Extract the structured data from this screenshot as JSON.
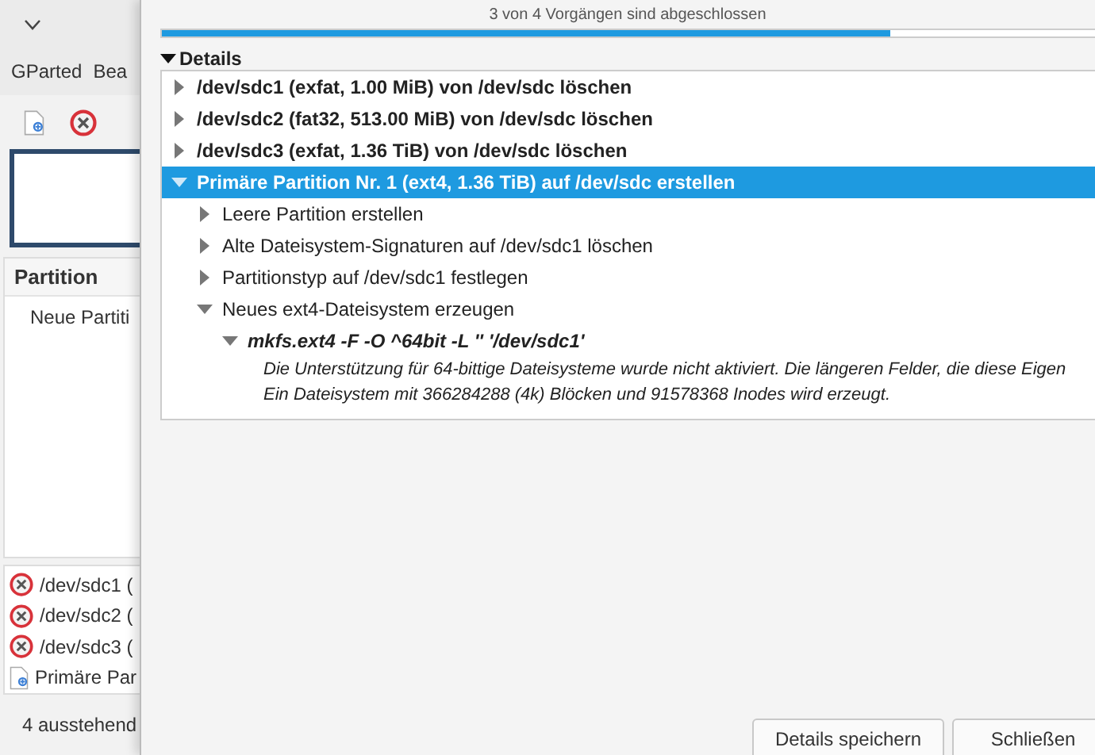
{
  "main_window": {
    "menu": [
      "GParted",
      "Bea"
    ],
    "partition_list": {
      "columns": [
        "Partition"
      ],
      "rows": [
        "Neue Partiti"
      ]
    },
    "pending_operations": [
      {
        "kind": "delete",
        "label": "/dev/sdc1 ("
      },
      {
        "kind": "delete",
        "label": "/dev/sdc2 ("
      },
      {
        "kind": "delete",
        "label": "/dev/sdc3 ("
      },
      {
        "kind": "create",
        "label": "Primäre Par"
      }
    ],
    "status_bar": "4 ausstehend"
  },
  "dialog": {
    "progress": {
      "text": "3 von 4 Vorgängen sind abgeschlossen",
      "level": 0.78
    },
    "details": {
      "label": "Details",
      "expanded": true,
      "items": [
        {
          "kind": "operation",
          "text": "/dev/sdc1 (exfat, 1.00 MiB) von /dev/sdc löschen",
          "expanded": false,
          "selected": false
        },
        {
          "kind": "operation",
          "text": "/dev/sdc2 (fat32, 513.00 MiB) von /dev/sdc löschen",
          "expanded": false,
          "selected": false
        },
        {
          "kind": "operation",
          "text": "/dev/sdc3 (exfat, 1.36 TiB) von /dev/sdc löschen",
          "expanded": false,
          "selected": false
        },
        {
          "kind": "operation",
          "text": "Primäre Partition Nr. 1 (ext4, 1.36 TiB) auf /dev/sdc erstellen",
          "expanded": true,
          "selected": true,
          "children": [
            {
              "kind": "step",
              "text": "Leere Partition erstellen",
              "expanded": false,
              "selected": false
            },
            {
              "kind": "step",
              "text": "Alte Dateisystem-Signaturen auf /dev/sdc1 löschen",
              "expanded": false,
              "selected": false
            },
            {
              "kind": "step",
              "text": "Partitionstyp auf /dev/sdc1 festlegen",
              "expanded": false,
              "selected": false
            },
            {
              "kind": "step",
              "text": "Neues ext4-Dateisystem erzeugen",
              "expanded": true,
              "selected": false,
              "children": [
                {
                  "kind": "command",
                  "text": "mkfs.ext4 -F -O ^64bit -L '' '/dev/sdc1'",
                  "expanded": true,
                  "selected": false,
                  "children": [
                    {
                      "kind": "output",
                      "text": "Die Unterstützung für 64-bittige Dateisysteme wurde nicht aktiviert. Die längeren Felder, die diese Eigen"
                    },
                    {
                      "kind": "output",
                      "text": "Ein Dateisystem mit 366284288 (4k) Blöcken und 91578368 Inodes wird erzeugt."
                    }
                  ]
                }
              ]
            }
          ]
        }
      ]
    },
    "buttons": [
      "Details speichern",
      "Schließen"
    ]
  }
}
